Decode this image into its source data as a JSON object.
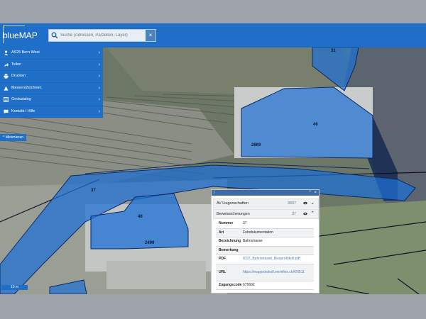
{
  "app": {
    "logo_text": "blueMAP"
  },
  "search": {
    "placeholder": "Suche (Adressen, Parzellen, Layer)",
    "clear_glyph": "×"
  },
  "sidebar": {
    "items": [
      {
        "label": "AS25 Bern West",
        "icon": "user-icon"
      },
      {
        "label": "Teilen",
        "icon": "share-icon"
      },
      {
        "label": "Drucken",
        "icon": "print-icon"
      },
      {
        "label": "Messen/Zeichnen",
        "icon": "ruler-icon"
      },
      {
        "label": "Geokatalog",
        "icon": "layers-icon"
      },
      {
        "label": "Kontakt / Hilfe",
        "icon": "chat-icon"
      }
    ],
    "minimize_label": "Minimieren"
  },
  "map": {
    "parcel_labels": [
      "31",
      "46",
      "2869",
      "37",
      "48",
      "2499"
    ],
    "scale_label": "10 m"
  },
  "panel": {
    "header_info": "i",
    "layer_rows": [
      {
        "name": "AV Liegenschaften",
        "count": "3807"
      },
      {
        "name": "Beweissicherungen",
        "count": "37"
      }
    ],
    "details": [
      {
        "key": "Nummer",
        "value": "37",
        "link": false
      },
      {
        "key": "Art",
        "value": "Fotodokumentation",
        "link": false
      },
      {
        "key": "Bezeichnung",
        "value": "Bahnstrasse",
        "link": false
      },
      {
        "key": "Bemerkung",
        "value": "",
        "link": false
      },
      {
        "key": "PDF",
        "value": "ID37_Bahnstrasse_Bissprotokoll.pdf",
        "link": true
      },
      {
        "key": "URL",
        "value": "https://mapprotokoll.vermflex.ch/KN511",
        "link": true
      },
      {
        "key": "Zugangscode",
        "value": "675662",
        "link": false
      }
    ]
  },
  "colors": {
    "topbar": "#1f6fc8",
    "parcel_fill": "#1c6fd6",
    "panel_header": "#3f6aa3"
  }
}
